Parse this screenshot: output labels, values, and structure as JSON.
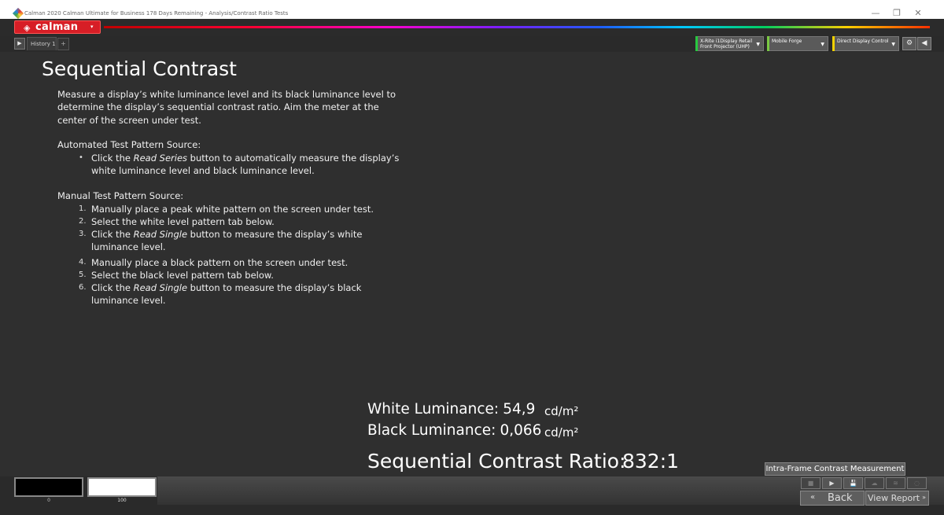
{
  "window": {
    "title": "Calman 2020 Calman Ultimate for Business 178 Days Remaining - Analysis/Contrast Ratio Tests",
    "minimize_glyph": "—",
    "restore_glyph": "❐",
    "close_glyph": "✕"
  },
  "app": {
    "logo_text": "calman",
    "logo_mark": "◈",
    "caret": "▾"
  },
  "tabs": {
    "history_label": "History 1",
    "add_label": "+"
  },
  "devices": [
    {
      "line1": "X-Rite i1Display Retail",
      "line2": "Front Projector (UHP)",
      "accent": "#28c840"
    },
    {
      "line1": "Mobile Forge",
      "line2": "",
      "accent": "#7ac943"
    },
    {
      "line1": "Direct Display Control",
      "line2": "",
      "accent": "#f0d000"
    }
  ],
  "toolbar": {
    "settings_glyph": "⚙",
    "next_glyph": "◀"
  },
  "page": {
    "title": "Sequential Contrast",
    "intro": "Measure a display’s white luminance level and its black luminance level to determine the display’s sequential contrast ratio. Aim the meter at the center of the screen under test.",
    "auto_heading": "Automated Test Pattern Source:",
    "auto_items": [
      {
        "marker": "•",
        "pre": "Click the ",
        "em": "Read Series",
        "post": " button to automatically measure the display’s white luminance level and black luminance level."
      }
    ],
    "manual_heading": "Manual Test Pattern Source:",
    "manual_items": [
      {
        "marker": "1.",
        "pre": "Manually place a peak white pattern on the screen under test.",
        "em": "",
        "post": ""
      },
      {
        "marker": "2.",
        "pre": "Select the white level pattern tab below.",
        "em": "",
        "post": ""
      },
      {
        "marker": "3.",
        "pre": "Click the ",
        "em": "Read Single",
        "post": " button to measure the display’s white luminance level."
      },
      {
        "marker": "4.",
        "pre": "Manually place a black pattern on the screen under test.",
        "em": "",
        "post": ""
      },
      {
        "marker": "5.",
        "pre": "Select the black level pattern tab below.",
        "em": "",
        "post": ""
      },
      {
        "marker": "6.",
        "pre": "Click the ",
        "em": "Read Single",
        "post": " button to measure the display’s black luminance level."
      }
    ]
  },
  "results": {
    "white_label": "White Luminance:",
    "white_value": "54,9",
    "black_label": "Black Luminance:",
    "black_value": "0,066",
    "unit": "cd/m²",
    "ratio_label": "Sequential Contrast Ratio:",
    "ratio_value": "832:1"
  },
  "intra_button": "Intra-Frame Contrast Measurement",
  "patterns": [
    {
      "label": "0",
      "color": "#000000"
    },
    {
      "label": "100",
      "color": "#ffffff"
    }
  ],
  "controls": {
    "stop_glyph": "■",
    "play_glyph": "▶",
    "save_glyph": "💾",
    "cloud_glyph": "☁",
    "db_glyph": "≋",
    "extra_glyph": "◌",
    "back_label": "Back",
    "back_glyph": "«",
    "report_label": "View Report",
    "report_glyph": "»"
  }
}
